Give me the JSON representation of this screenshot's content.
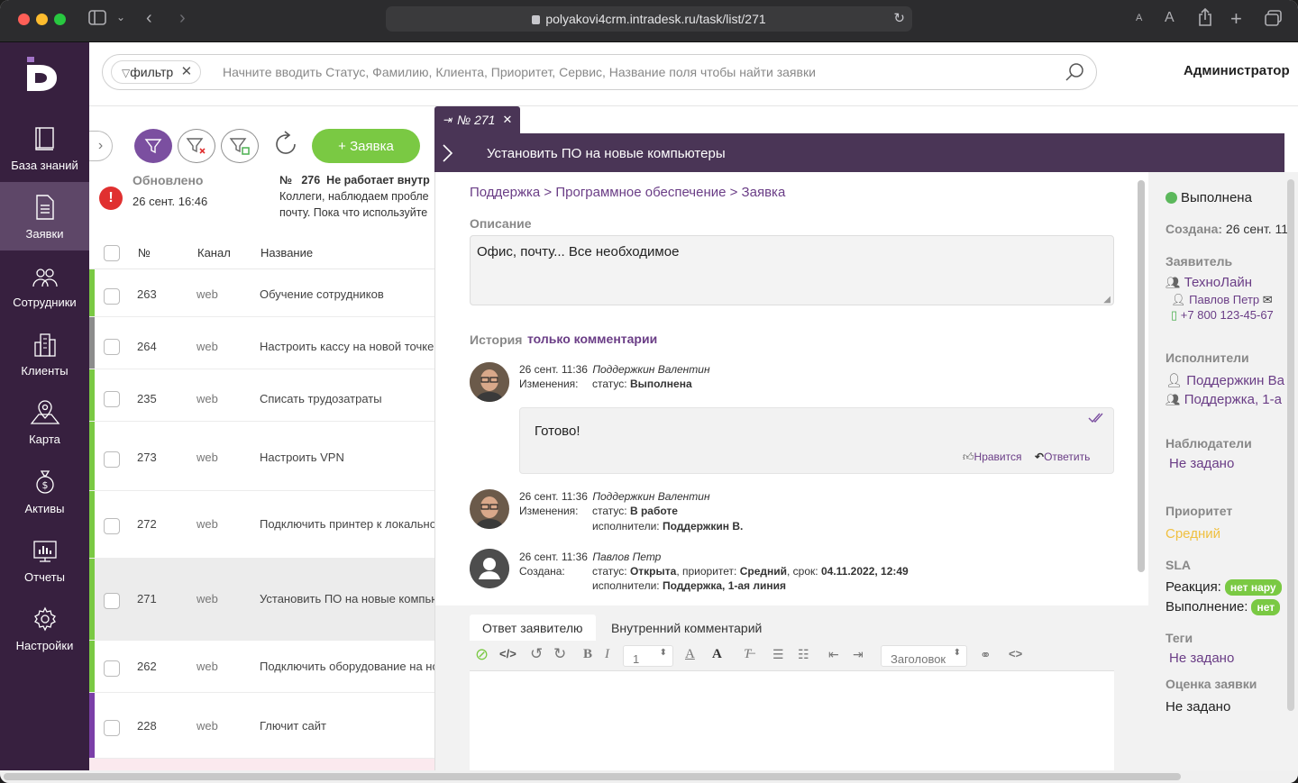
{
  "browser": {
    "url": "polyakovi4crm.intradesk.ru/task/list/271"
  },
  "search": {
    "filter_chip": "фильтр",
    "placeholder": "Начните вводить Статус, Фамилию, Клиента, Приоритет, Сервис, Название поля чтобы найти заявки"
  },
  "user": {
    "name": "Администратор"
  },
  "sidebar": {
    "items": [
      {
        "label": "База знаний",
        "icon": "book-icon"
      },
      {
        "label": "Заявки",
        "icon": "document-icon"
      },
      {
        "label": "Сотрудники",
        "icon": "people-icon"
      },
      {
        "label": "Клиенты",
        "icon": "buildings-icon"
      },
      {
        "label": "Карта",
        "icon": "map-pin-icon"
      },
      {
        "label": "Активы",
        "icon": "money-bag-icon"
      },
      {
        "label": "Отчеты",
        "icon": "chart-icon"
      },
      {
        "label": "Настройки",
        "icon": "gear-icon"
      }
    ]
  },
  "toolbar": {
    "new_label": "+ Заявка"
  },
  "update": {
    "label": "Обновлено",
    "time": "26 сент. 16:46",
    "num_label": "№",
    "task_num": "276",
    "task_title": "Не работает внутр",
    "text1": "Коллеги, наблюдаем пробле",
    "text2": "почту. Пока что используйте"
  },
  "table": {
    "headers": {
      "num": "№",
      "channel": "Канал",
      "title": "Название"
    },
    "rows": [
      {
        "num": "263",
        "channel": "web",
        "title": "Обучение сотрудников",
        "color": "#7ac943"
      },
      {
        "num": "264",
        "channel": "web",
        "title": "Настроить кассу на новой точке",
        "color": "#8c8c8c"
      },
      {
        "num": "235",
        "channel": "web",
        "title": "Списать трудозатраты",
        "color": "#7ac943"
      },
      {
        "num": "273",
        "channel": "web",
        "title": "Настроить VPN",
        "color": "#7ac943"
      },
      {
        "num": "272",
        "channel": "web",
        "title": "Подключить принтер к локальной",
        "color": "#7ac943"
      },
      {
        "num": "271",
        "channel": "web",
        "title": "Установить ПО на новые компьютеры",
        "color": "#7ac943"
      },
      {
        "num": "262",
        "channel": "web",
        "title": "Подключить оборудование на новой",
        "color": "#7ac943"
      },
      {
        "num": "228",
        "channel": "web",
        "title": "Глючит сайт",
        "color": "#7b3fa8"
      }
    ]
  },
  "detail": {
    "tab_label": "№ 271",
    "title": "Установить ПО на новые компьютеры",
    "breadcrumb": "Поддержка  >  Программное обеспечение >  Заявка",
    "desc_label": "Описание",
    "description": "Офис, почту... Все необходимое",
    "history_label": "История",
    "history_filter": "только комментарии",
    "history": [
      {
        "time": "26 сент. 11:36",
        "author": "Поддержкин Валентин",
        "kind": "Изменения:",
        "line1_k": "статус:",
        "line1_v": "Выполнена"
      },
      {
        "comment": "Готово!",
        "like": "Нравится",
        "reply": "Ответить"
      },
      {
        "time": "26 сент. 11:36",
        "author": "Поддержкин Валентин",
        "kind": "Изменения:",
        "line1_k": "статус:",
        "line1_v": "В работе",
        "line2_k": "исполнители:",
        "line2_v": "Поддержкин В."
      },
      {
        "time": "26 сент. 11:36",
        "author": "Павлов Петр",
        "kind": "Создана:",
        "line1_k": "статус:",
        "line1_v": "Открыта",
        "line1_k2": ", приоритет:",
        "line1_v2": "Средний",
        "line1_k3": ", срок:",
        "line1_v3": "04.11.2022, 12:49",
        "line2_k": "исполнители:",
        "line2_v": "Поддержка, 1-ая линия"
      }
    ],
    "reply_tabs": [
      "Ответ заявителю",
      "Внутренний комментарий"
    ],
    "editor": {
      "font_size": "1",
      "heading": "Заголовок"
    }
  },
  "right": {
    "status": "Выполнена",
    "status_color": "#5cb85c",
    "created_label": "Создана:",
    "created_value": "26 сент. 11:",
    "requester_label": "Заявитель",
    "requester_org": "ТехноЛайн",
    "requester_person": "Павлов Петр",
    "requester_phone": "+7 800 123-45-67",
    "executors_label": "Исполнители",
    "executor1": "Поддержкин Ва",
    "executor2": "Поддержка, 1-а",
    "watchers_label": "Наблюдатели",
    "watchers_value": "Не задано",
    "priority_label": "Приоритет",
    "priority_value": "Средний",
    "sla_label": "SLA",
    "reaction_label": "Реакция:",
    "reaction_badge": "нет нару",
    "execution_label": "Выполнение:",
    "execution_badge": "нет",
    "tags_label": "Теги",
    "tags_value": "Не задано",
    "rating_label": "Оценка заявки",
    "rating_value": "Не задано"
  }
}
